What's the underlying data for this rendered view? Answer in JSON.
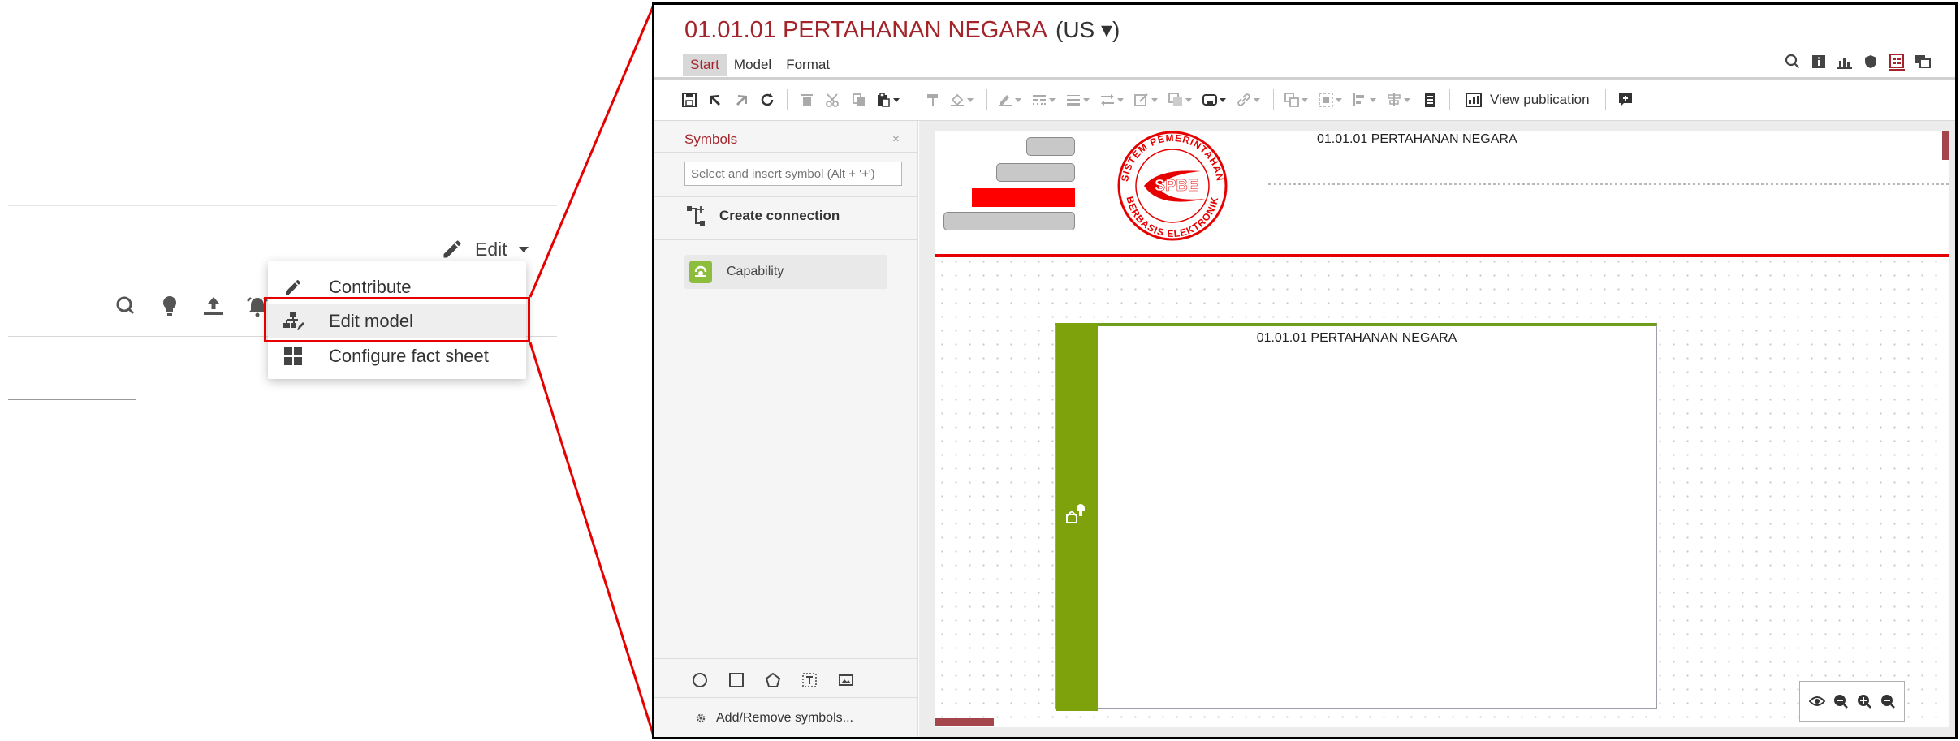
{
  "left_panel": {
    "edit_label": "Edit",
    "dropdown": {
      "items": [
        {
          "label": "Contribute",
          "icon": "pencil-icon"
        },
        {
          "label": "Edit model",
          "icon": "edit-model-icon"
        },
        {
          "label": "Configure fact sheet",
          "icon": "grid-icon"
        }
      ]
    },
    "toolbar_icons": [
      "search-icon",
      "lightbulb-icon",
      "upload-icon",
      "alarm-icon"
    ]
  },
  "editor": {
    "title": "01.01.01 PERTAHANAN NEGARA",
    "language": "(US ▾)",
    "tabs": [
      {
        "label": "Start",
        "active": true
      },
      {
        "label": "Model",
        "active": false
      },
      {
        "label": "Format",
        "active": false
      }
    ],
    "view_publication_label": "View publication",
    "symbols_panel": {
      "heading": "Symbols",
      "close_glyph": "×",
      "search_placeholder": "Select and insert symbol (Alt + '+')",
      "create_connection_label": "Create connection",
      "capability_label": "Capability",
      "add_remove_label": "Add/Remove symbols..."
    },
    "canvas": {
      "header_title": "01.01.01 PERTAHANAN NEGARA",
      "logo": {
        "text_top": "SISTEM PEMERINTAHAN",
        "text_center": "SPBE",
        "text_bottom": "BERBASIS ELEKTRONIK"
      },
      "capability_box_title": "01.01.01 PERTAHANAN NEGARA"
    }
  },
  "colors": {
    "accent_red": "#a3252b",
    "highlight_red": "#e60000",
    "capability_green": "#7da20b",
    "capability_icon_green": "#8cbd3c"
  }
}
